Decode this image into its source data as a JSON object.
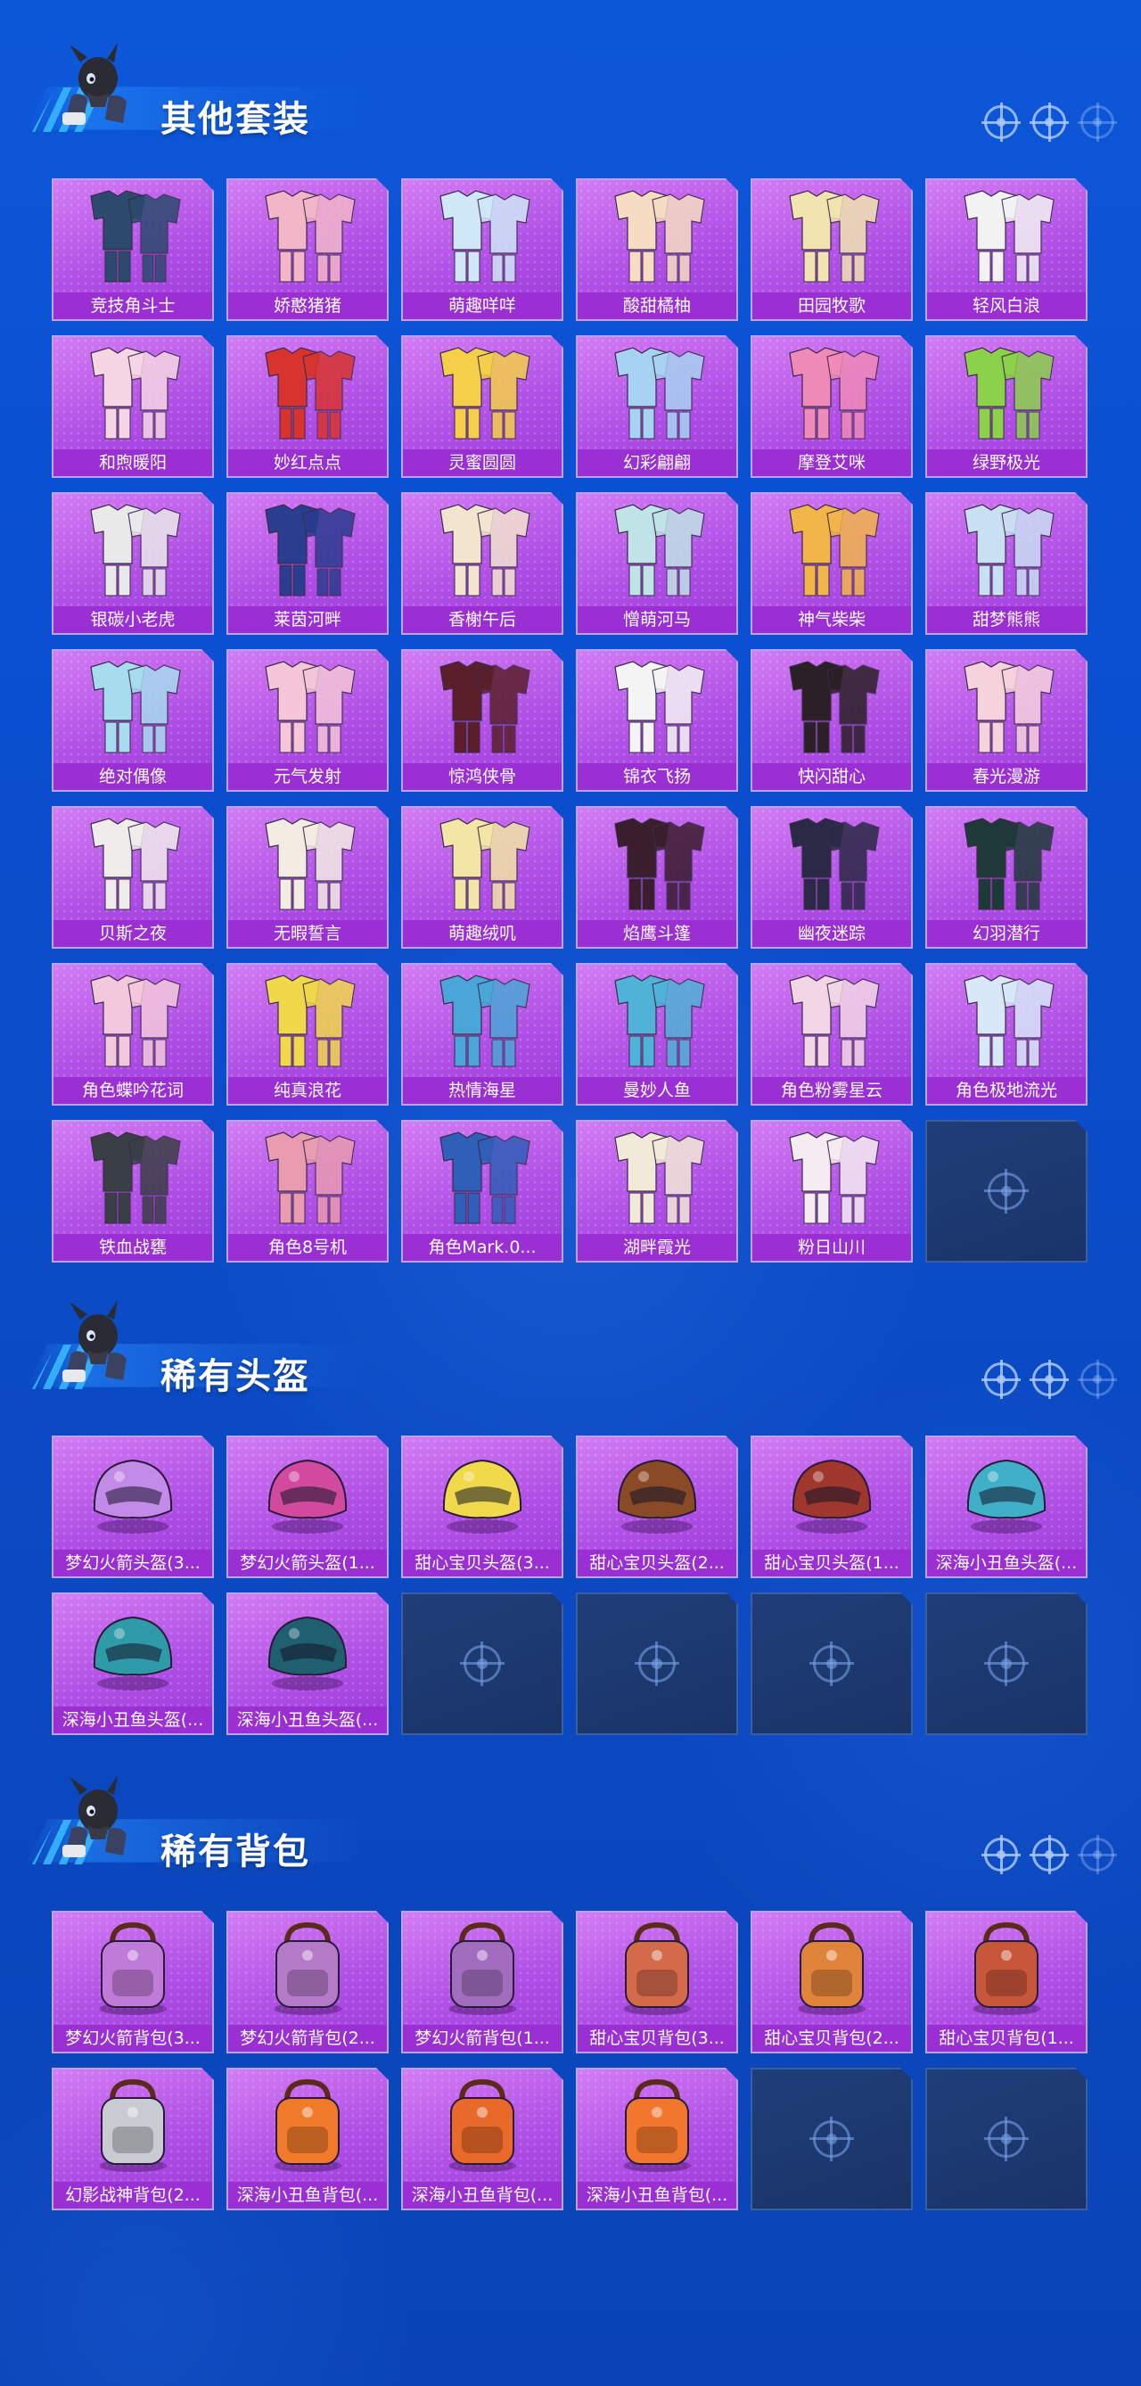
{
  "colors": {
    "background": "#0b4fd0",
    "card_purple": "#b050e6",
    "label_bar": "#9a2fd3",
    "empty_slot": "#1f3e79",
    "title_text": "#ffffff"
  },
  "icons": {
    "mascot": "mascot-icon",
    "header_decor": "crosshair-icon",
    "empty_slot": "crosshair-icon",
    "outfit": "outfit-icon",
    "helmet": "helmet-icon",
    "backpack": "backpack-icon"
  },
  "sections": [
    {
      "title": "其他套装",
      "kind": "outfit",
      "items": [
        {
          "label": "竞技角斗士",
          "color": "#2b4a6e"
        },
        {
          "label": "娇憨猪猪",
          "color": "#f3b6c9"
        },
        {
          "label": "萌趣咩咩",
          "color": "#cfe7f7"
        },
        {
          "label": "酸甜橘柚",
          "color": "#f6dcc2"
        },
        {
          "label": "田园牧歌",
          "color": "#f1e4b0"
        },
        {
          "label": "轻风白浪",
          "color": "#f2f2f2"
        },
        {
          "label": "和煦暖阳",
          "color": "#f6d6e4"
        },
        {
          "label": "妙红点点",
          "color": "#d8342f"
        },
        {
          "label": "灵蜜圆圆",
          "color": "#f5cf49"
        },
        {
          "label": "幻彩翩翩",
          "color": "#a8d2f2"
        },
        {
          "label": "摩登艾咪",
          "color": "#f08ab8"
        },
        {
          "label": "绿野极光",
          "color": "#8bd14a"
        },
        {
          "label": "银碳小老虎",
          "color": "#e9e9e9"
        },
        {
          "label": "莱茵河畔",
          "color": "#2a3d8f"
        },
        {
          "label": "香榭午后",
          "color": "#f3e4cf"
        },
        {
          "label": "憎萌河马",
          "color": "#bfe3e6"
        },
        {
          "label": "神气柴柴",
          "color": "#f2b54a"
        },
        {
          "label": "甜梦熊熊",
          "color": "#c9dff2"
        },
        {
          "label": "绝对偶像",
          "color": "#a7dcef"
        },
        {
          "label": "元气发射",
          "color": "#f4c6d8"
        },
        {
          "label": "惊鸿侠骨",
          "color": "#5b1f2a"
        },
        {
          "label": "锦衣飞扬",
          "color": "#f4f4f4"
        },
        {
          "label": "快闪甜心",
          "color": "#2b2025"
        },
        {
          "label": "春光漫游",
          "color": "#f6d2dd"
        },
        {
          "label": "贝斯之夜",
          "color": "#f0eceb"
        },
        {
          "label": "无暇誓言",
          "color": "#f3ece3"
        },
        {
          "label": "萌趣绒叽",
          "color": "#f3e5a5"
        },
        {
          "label": "焰鹰斗篷",
          "color": "#3a1e2e"
        },
        {
          "label": "幽夜迷踪",
          "color": "#2a2946"
        },
        {
          "label": "幻羽潜行",
          "color": "#1e3a38"
        },
        {
          "label": "角色蝶吟花词",
          "color": "#f4c8dc"
        },
        {
          "label": "纯真浪花",
          "color": "#f0d84a"
        },
        {
          "label": "热情海星",
          "color": "#4aa6d8"
        },
        {
          "label": "曼妙人鱼",
          "color": "#4fb2d6"
        },
        {
          "label": "角色粉雾星云",
          "color": "#f3d6e6"
        },
        {
          "label": "角色极地流光",
          "color": "#d8e8f8"
        },
        {
          "label": "铁血战甕",
          "color": "#3a3f46"
        },
        {
          "label": "角色8号机",
          "color": "#e99bb0"
        },
        {
          "label": "角色Mark.0...",
          "color": "#2f5fb8"
        },
        {
          "label": "湖畔霞光",
          "color": "#f2ead8"
        },
        {
          "label": "粉日山川",
          "color": "#f5ecf2"
        },
        {
          "label": "",
          "empty": true
        }
      ]
    },
    {
      "title": "稀有头盔",
      "kind": "helmet",
      "items": [
        {
          "label": "梦幻火箭头盔(3...",
          "color": "#c38be8"
        },
        {
          "label": "梦幻火箭头盔(1...",
          "color": "#d14a9e"
        },
        {
          "label": "甜心宝贝头盔(3...",
          "color": "#f0d94a"
        },
        {
          "label": "甜心宝贝头盔(2...",
          "color": "#8a4a26"
        },
        {
          "label": "甜心宝贝头盔(1...",
          "color": "#a0372d"
        },
        {
          "label": "深海小丑鱼头盔(...",
          "color": "#3fb0c8"
        },
        {
          "label": "深海小丑鱼头盔(...",
          "color": "#2f9aa8"
        },
        {
          "label": "深海小丑鱼头盔(...",
          "color": "#1f5f70"
        },
        {
          "label": "",
          "empty": true
        },
        {
          "label": "",
          "empty": true
        },
        {
          "label": "",
          "empty": true
        },
        {
          "label": "",
          "empty": true
        }
      ]
    },
    {
      "title": "稀有背包",
      "kind": "backpack",
      "items": [
        {
          "label": "梦幻火箭背包(3...",
          "color": "#c07ad8"
        },
        {
          "label": "梦幻火箭背包(2...",
          "color": "#b47ac8"
        },
        {
          "label": "梦幻火箭背包(1...",
          "color": "#a26dbf"
        },
        {
          "label": "甜心宝贝背包(3...",
          "color": "#d36a4a"
        },
        {
          "label": "甜心宝贝背包(2...",
          "color": "#e0843c"
        },
        {
          "label": "甜心宝贝背包(1...",
          "color": "#c8563a"
        },
        {
          "label": "幻影战神背包(2...",
          "color": "#c9cbd2"
        },
        {
          "label": "深海小丑鱼背包(...",
          "color": "#f07a2a"
        },
        {
          "label": "深海小丑鱼背包(...",
          "color": "#e8692a"
        },
        {
          "label": "深海小丑鱼背包(...",
          "color": "#f2762e"
        },
        {
          "label": "",
          "empty": true
        },
        {
          "label": "",
          "empty": true
        }
      ]
    }
  ]
}
